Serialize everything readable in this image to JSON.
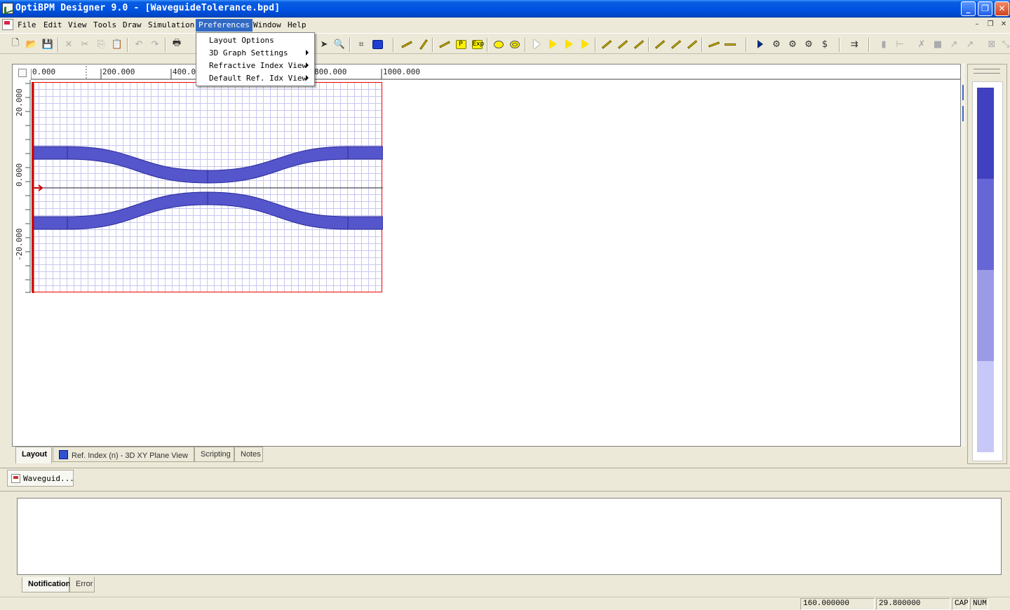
{
  "window": {
    "title": "OptiBPM Designer 9.0 - [WaveguideTolerance.bpd]"
  },
  "titlebar_buttons": {
    "minimize": "_",
    "restore": "❐",
    "close": "✕"
  },
  "menu": {
    "file": "File",
    "edit": "Edit",
    "view": "View",
    "tools": "Tools",
    "draw": "Draw",
    "simulation": "Simulation",
    "preferences": "Preferences",
    "window": "Window",
    "help": "Help"
  },
  "mdi_controls": {
    "minimize": "–",
    "restore": "❐",
    "close": "✕"
  },
  "preferences_menu": [
    {
      "label": "Layout Options",
      "submenu": false
    },
    {
      "label": "3D Graph Settings",
      "submenu": true
    },
    {
      "label": "Refractive Index View",
      "submenu": true
    },
    {
      "label": "Default Ref. Idx View",
      "submenu": true
    }
  ],
  "ruler": {
    "top": [
      "0.000",
      "200.000",
      "400.00",
      "800.000",
      "1000.000"
    ],
    "left": [
      "20.000",
      "0.000",
      "-20.000"
    ]
  },
  "view_tabs": {
    "layout": "Layout",
    "ref_index": "Ref. Index (n) - 3D XY Plane View",
    "scripting": "Scripting",
    "notes": "Notes"
  },
  "document_tab": "Waveguid...",
  "output_tabs": {
    "notification": "Notification",
    "error": "Error"
  },
  "status": {
    "x": "160.000000",
    "y": "29.800000",
    "caps": "CAP",
    "num": "NUM"
  },
  "colors": {
    "waveguide": "#5555cc",
    "waveguide_edge": "#2a2a99",
    "boundary": "#dd0000",
    "grid": "#c8c8f0"
  },
  "palette_colors": [
    "#4040c0",
    "#6666d6",
    "#9a9ae6",
    "#c8c8f8"
  ],
  "icons": {
    "toolbar": [
      "new-file-icon",
      "open-folder-icon",
      "save-icon",
      "cut-icon",
      "copy-icon",
      "paste-icon",
      "undo-icon",
      "redo-icon",
      "print-icon",
      "select-arrow-icon",
      "zoom-icon",
      "scan-icon",
      "camera-icon",
      "waveguide-linear-icon",
      "waveguide-arc-icon",
      "run-simulation-icon"
    ]
  }
}
